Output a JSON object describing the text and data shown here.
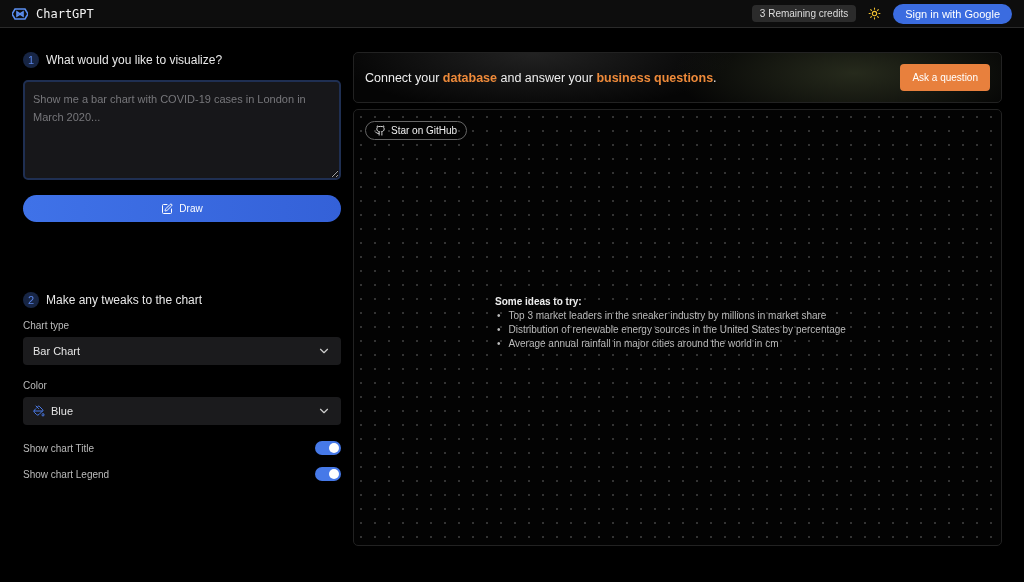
{
  "header": {
    "logo": "ChartGPT",
    "credits": "3 Remaining credits",
    "sign_in": "Sign in with Google"
  },
  "step1": {
    "number": "1",
    "title": "What would you like to visualize?",
    "prompt": {
      "placeholder": "Show me a bar chart with COVID-19 cases in London in March 2020..."
    },
    "draw_button": "Draw"
  },
  "step2": {
    "number": "2",
    "title": "Make any tweaks to the chart",
    "selects": [
      {
        "label": "Chart type",
        "value": "Bar Chart",
        "kind": "plain"
      },
      {
        "label": "Color",
        "value": "Blue",
        "kind": "palette"
      }
    ],
    "toggles": [
      {
        "label": "Show chart Title",
        "on": true
      },
      {
        "label": "Show chart Legend",
        "on": true
      }
    ]
  },
  "banner": {
    "text": "Connect your **database** and answer your **business questions**.",
    "button": "Ask a question"
  },
  "canvas": {
    "github_button": "Star on GitHub",
    "ideas_title": "Some ideas to try:",
    "ideas": [
      {
        "bullet": "•",
        "text": "Top 3 market leaders in the sneaker industry by millions in market share"
      },
      {
        "bullet": "•",
        "text": "Distribution of renewable energy sources in the United States by percentage"
      },
      {
        "bullet": "•",
        "text": "Average annual rainfall in major cities around the world in cm"
      }
    ]
  }
}
